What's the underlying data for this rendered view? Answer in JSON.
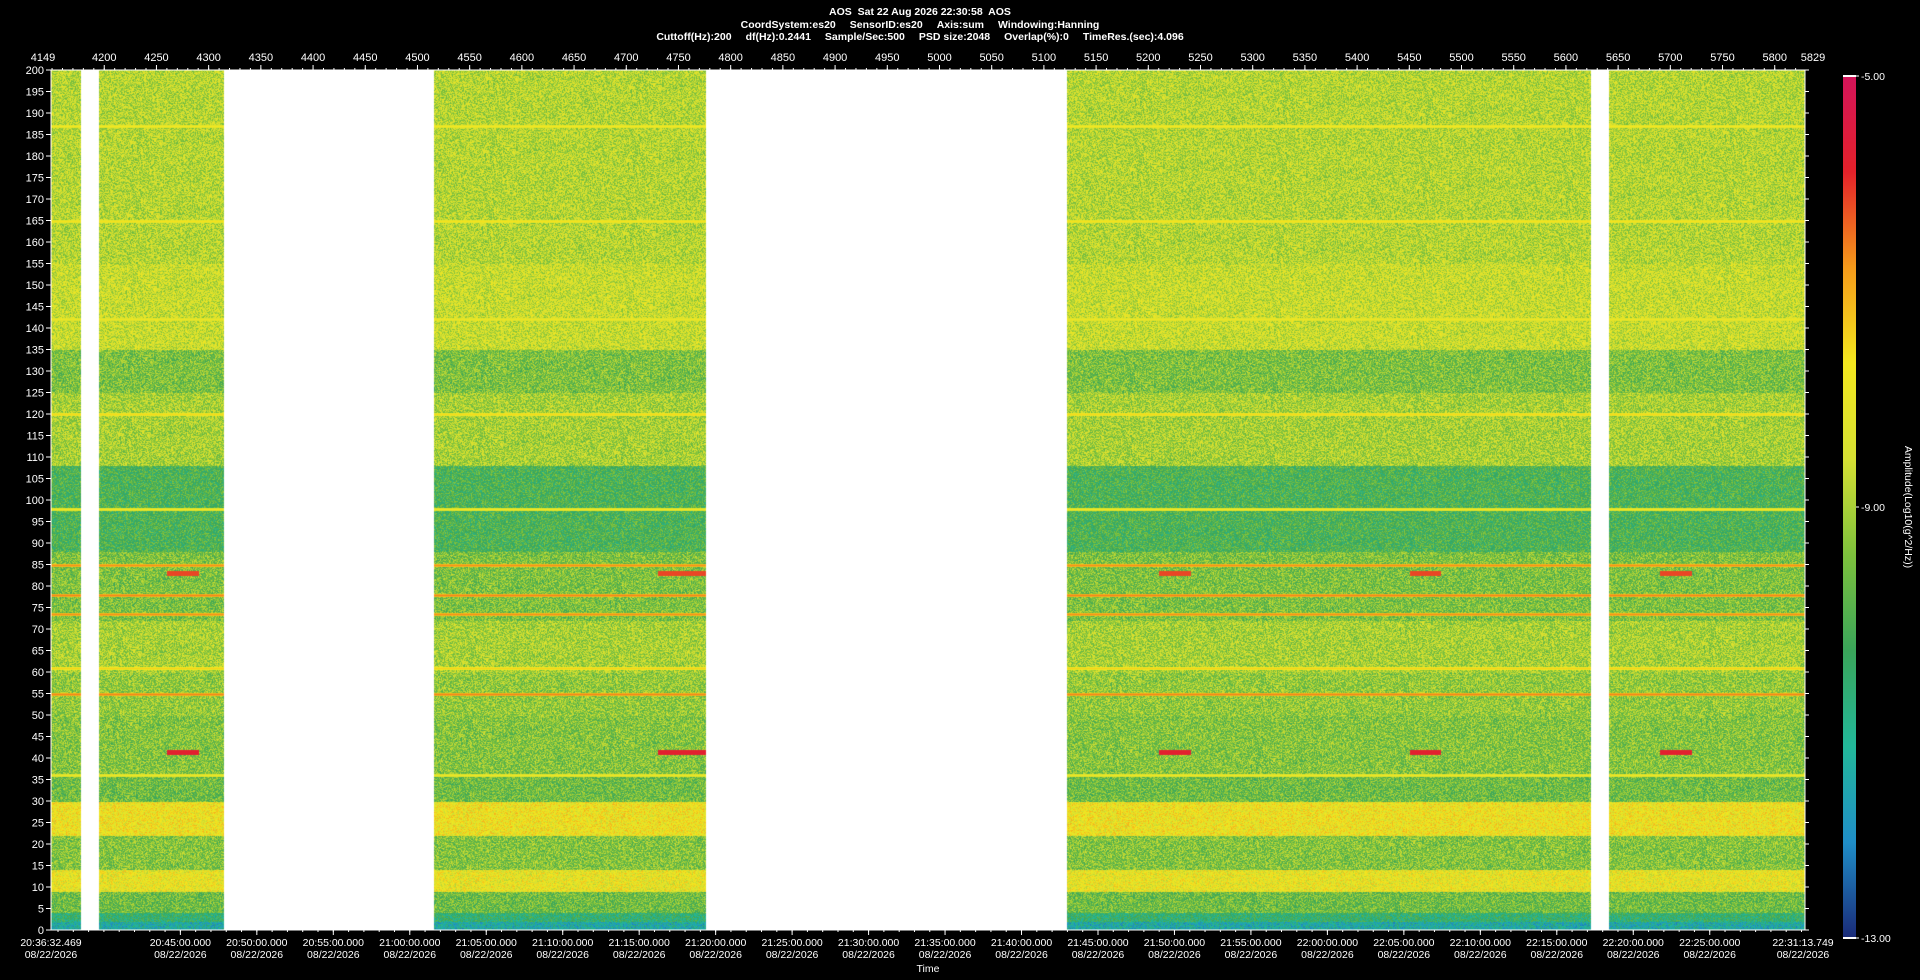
{
  "header": {
    "line1": "AOS  Sat 22 Aug 2026 22:30:58  AOS",
    "line2": [
      "CoordSystem:es20",
      "SensorID:es20",
      "Axis:sum",
      "Windowing:Hanning"
    ],
    "line3": [
      "Cuttoff(Hz):200",
      "df(Hz):0.2441",
      "Sample/Sec:500",
      "PSD size:2048",
      "Overlap(%):0",
      "TimeRes.(sec):4.096"
    ]
  },
  "chart_data": {
    "type": "heatmap",
    "xlabel": "Time",
    "colorbar_label": "Amplitude(Log10(g^2/Hz))",
    "colorbar_ticks": [
      "-5.00",
      "-9.00",
      "-13.00"
    ],
    "clim": [
      -13,
      -5
    ],
    "ylim": [
      0,
      200
    ],
    "yticks": [
      0,
      5,
      10,
      15,
      20,
      25,
      30,
      35,
      40,
      45,
      50,
      55,
      60,
      65,
      70,
      75,
      80,
      85,
      90,
      95,
      100,
      105,
      110,
      115,
      120,
      125,
      130,
      135,
      140,
      145,
      150,
      155,
      160,
      165,
      170,
      175,
      180,
      185,
      190,
      195,
      200
    ],
    "top_axis": {
      "range": [
        4149,
        5829
      ],
      "end_labels": [
        "4149",
        "5829"
      ],
      "ticks": [
        4200,
        4250,
        4300,
        4350,
        4400,
        4450,
        4500,
        4550,
        4600,
        4650,
        4700,
        4750,
        4800,
        4850,
        4900,
        4950,
        5000,
        5050,
        5100,
        5150,
        5200,
        5250,
        5300,
        5350,
        5400,
        5450,
        5500,
        5550,
        5600,
        5650,
        5700,
        5750,
        5800
      ]
    },
    "time_axis": {
      "start": "20:36:32.469",
      "end": "22:31:13.749",
      "date": "08/22/2026",
      "ticks": [
        "20:45:00.000",
        "20:50:00.000",
        "20:55:00.000",
        "21:00:00.000",
        "21:05:00.000",
        "21:10:00.000",
        "21:15:00.000",
        "21:20:00.000",
        "21:25:00.000",
        "21:30:00.000",
        "21:35:00.000",
        "21:40:00.000",
        "21:45:00.000",
        "21:50:00.000",
        "21:55:00.000",
        "22:00:00.000",
        "22:05:00.000",
        "22:10:00.000",
        "22:15:00.000",
        "22:20:00.000",
        "22:25:00.000"
      ]
    },
    "data_segments": [
      {
        "from": 4149,
        "to": 4178
      },
      {
        "from": 4195,
        "to": 4315
      },
      {
        "from": 4516,
        "to": 4776
      },
      {
        "from": 5122,
        "to": 5624
      },
      {
        "from": 5641,
        "to": 5829
      }
    ],
    "tones_hz": [
      {
        "freq": 85,
        "strength": 0.95
      },
      {
        "freq": 78,
        "strength": 1.0
      },
      {
        "freq": 73.5,
        "strength": 0.95
      },
      {
        "freq": 55,
        "strength": 1.0
      },
      {
        "freq": 61,
        "strength": 0.6
      },
      {
        "freq": 120,
        "strength": 0.55
      },
      {
        "freq": 165,
        "strength": 0.5
      },
      {
        "freq": 187,
        "strength": 0.45
      },
      {
        "freq": 142,
        "strength": 0.35
      },
      {
        "freq": 98,
        "strength": 0.4
      },
      {
        "freq": 36,
        "strength": 0.35
      }
    ],
    "events": [
      {
        "x_from": 4260,
        "x_to": 4290,
        "freq": 41.5,
        "level": 1.0
      },
      {
        "x_from": 4260,
        "x_to": 4290,
        "freq": 83,
        "level": 0.85
      },
      {
        "x_from": 4730,
        "x_to": 4776,
        "freq": 41.5,
        "level": 1.0
      },
      {
        "x_from": 4730,
        "x_to": 4776,
        "freq": 83,
        "level": 0.85
      },
      {
        "x_from": 5210,
        "x_to": 5240,
        "freq": 41.5,
        "level": 1.0
      },
      {
        "x_from": 5210,
        "x_to": 5240,
        "freq": 83,
        "level": 0.85
      },
      {
        "x_from": 5450,
        "x_to": 5480,
        "freq": 41.5,
        "level": 1.0
      },
      {
        "x_from": 5450,
        "x_to": 5480,
        "freq": 83,
        "level": 0.85
      },
      {
        "x_from": 5690,
        "x_to": 5720,
        "freq": 41.5,
        "level": 1.0
      },
      {
        "x_from": 5690,
        "x_to": 5720,
        "freq": 83,
        "level": 0.85
      }
    ],
    "colors": [
      "#1a2a78",
      "#1f8ec8",
      "#22b89a",
      "#3aa55a",
      "#7dc13c",
      "#d6e033",
      "#f4e81e",
      "#f59a1a",
      "#e4212a",
      "#d4145a"
    ]
  }
}
